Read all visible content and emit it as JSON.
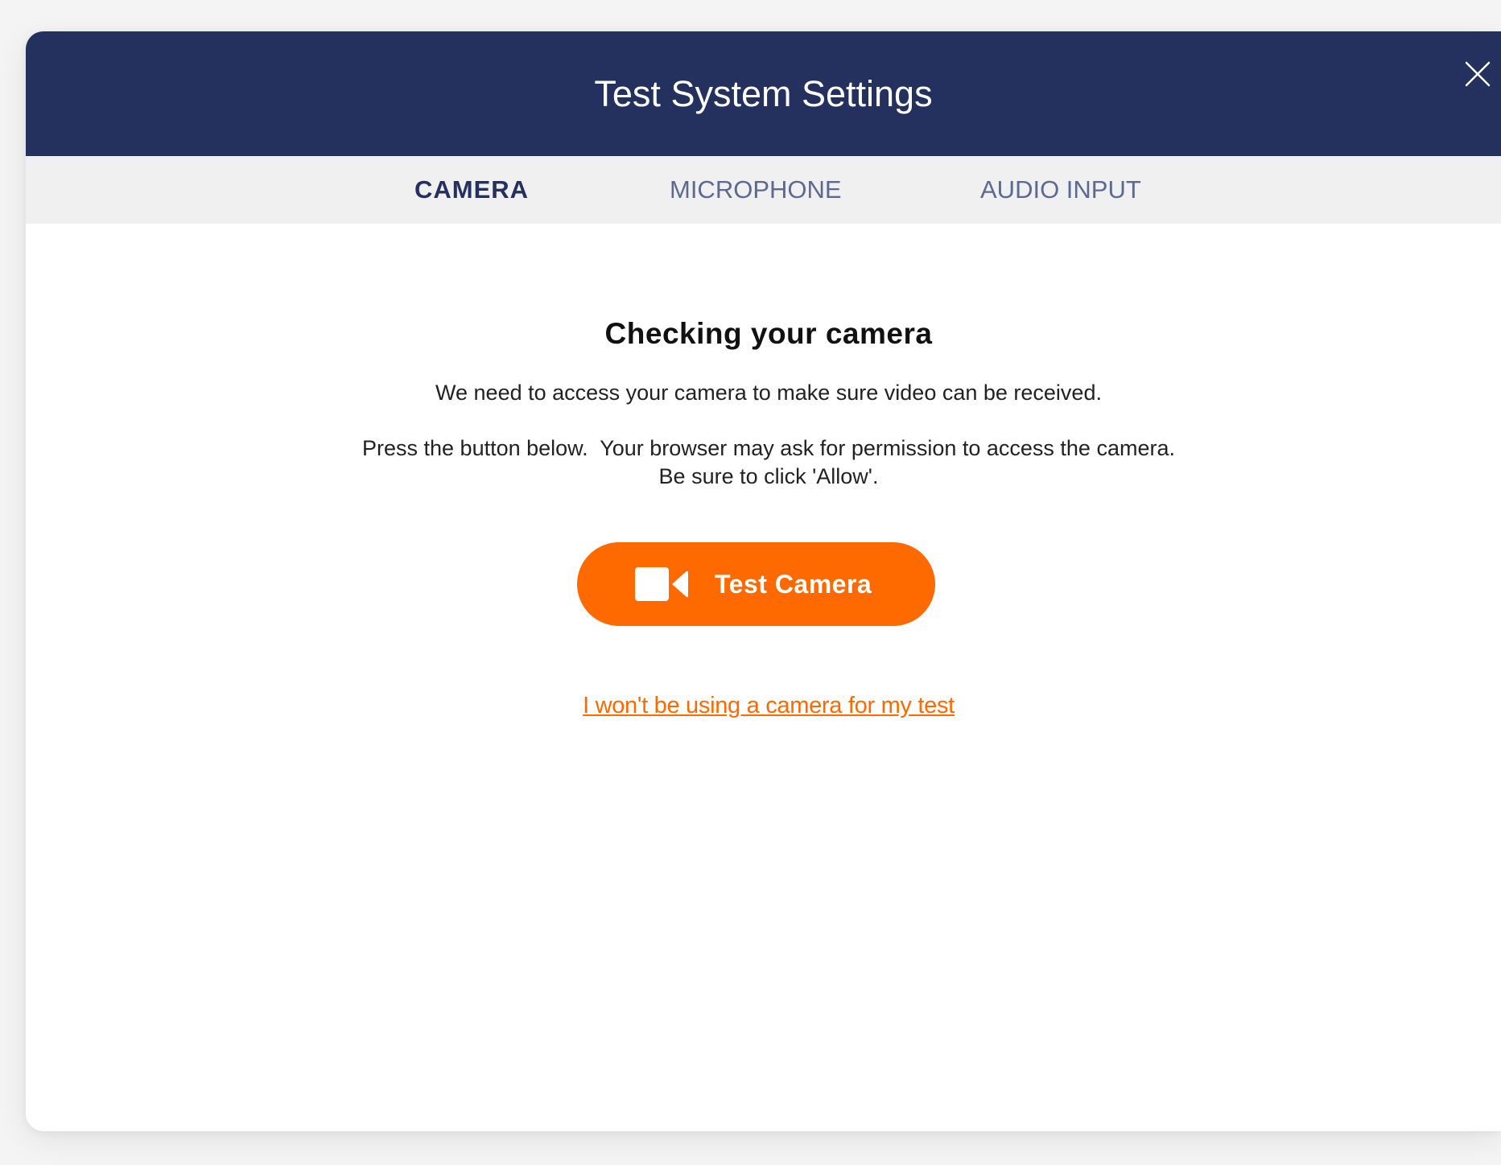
{
  "modal": {
    "title": "Test System Settings"
  },
  "tabs": [
    {
      "label": "CAMERA",
      "active": true
    },
    {
      "label": "MICROPHONE",
      "active": false
    },
    {
      "label": "AUDIO INPUT",
      "active": false
    }
  ],
  "content": {
    "heading": "Checking your camera",
    "paragraph1": "We need to access your camera to make sure video can be received.",
    "paragraph2_line1": "Press the button below.  Your browser may ask for permission to access the camera.",
    "paragraph2_line2": "Be sure to click 'Allow'.",
    "test_button": {
      "label": "Test Camera",
      "icon": "video-camera-icon"
    },
    "skip_link": "I won't be using a camera for my test"
  },
  "colors": {
    "header_bg": "#24305e",
    "tab_bar_bg": "#f0f0f0",
    "accent": "#ff6a00",
    "tab_active": "#24305e",
    "tab_inactive": "#5c6a90"
  },
  "icons": {
    "close": "close-icon",
    "camera": "video-camera-icon"
  }
}
